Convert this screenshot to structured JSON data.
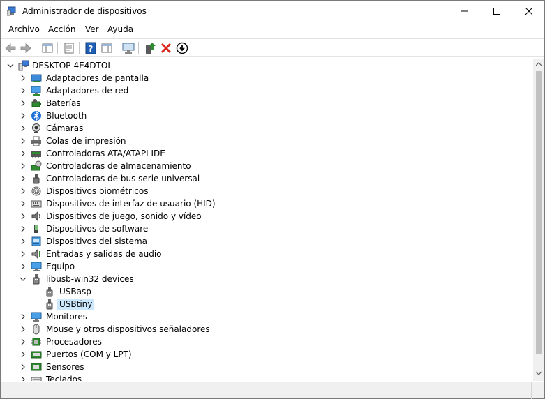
{
  "window": {
    "title": "Administrador de dispositivos"
  },
  "menu": [
    "Archivo",
    "Acción",
    "Ver",
    "Ayuda"
  ],
  "toolbar": {
    "buttons": [
      "back",
      "forward",
      "show-hide-console-tree",
      "properties",
      "help",
      "action-pane",
      "scan-hardware",
      "update-driver",
      "uninstall-device",
      "disable-device"
    ]
  },
  "tree": {
    "root": "DESKTOP-4E4DTOI",
    "items": [
      {
        "label": "Adaptadores de pantalla",
        "icon": "display-adapter-icon",
        "expanded": false
      },
      {
        "label": "Adaptadores de red",
        "icon": "network-adapter-icon",
        "expanded": false
      },
      {
        "label": "Baterías",
        "icon": "battery-icon",
        "expanded": false
      },
      {
        "label": "Bluetooth",
        "icon": "bluetooth-icon",
        "expanded": false
      },
      {
        "label": "Cámaras",
        "icon": "camera-icon",
        "expanded": false
      },
      {
        "label": "Colas de impresión",
        "icon": "printer-icon",
        "expanded": false
      },
      {
        "label": "Controladoras ATA/ATAPI IDE",
        "icon": "ide-controller-icon",
        "expanded": false
      },
      {
        "label": "Controladoras de almacenamiento",
        "icon": "storage-controller-icon",
        "expanded": false
      },
      {
        "label": "Controladoras de bus serie universal",
        "icon": "usb-controller-icon",
        "expanded": false
      },
      {
        "label": "Dispositivos biométricos",
        "icon": "fingerprint-icon",
        "expanded": false
      },
      {
        "label": "Dispositivos de interfaz de usuario (HID)",
        "icon": "hid-icon",
        "expanded": false
      },
      {
        "label": "Dispositivos de juego, sonido y vídeo",
        "icon": "speaker-icon",
        "expanded": false
      },
      {
        "label": "Dispositivos de software",
        "icon": "software-device-icon",
        "expanded": false
      },
      {
        "label": "Dispositivos del sistema",
        "icon": "system-device-icon",
        "expanded": false
      },
      {
        "label": "Entradas y salidas de audio",
        "icon": "audio-io-icon",
        "expanded": false
      },
      {
        "label": "Equipo",
        "icon": "computer-icon",
        "expanded": false
      },
      {
        "label": "libusb-win32 devices",
        "icon": "usb-plug-icon",
        "expanded": true,
        "children": [
          {
            "label": "USBasp",
            "icon": "usb-plug-icon",
            "selected": false
          },
          {
            "label": "USBtiny",
            "icon": "usb-plug-icon",
            "selected": true
          }
        ]
      },
      {
        "label": "Monitores",
        "icon": "monitor-icon",
        "expanded": false
      },
      {
        "label": "Mouse y otros dispositivos señaladores",
        "icon": "mouse-icon",
        "expanded": false
      },
      {
        "label": "Procesadores",
        "icon": "processor-icon",
        "expanded": false
      },
      {
        "label": "Puertos (COM y LPT)",
        "icon": "port-icon",
        "expanded": false
      },
      {
        "label": "Sensores",
        "icon": "sensor-icon",
        "expanded": false
      },
      {
        "label": "Teclados",
        "icon": "keyboard-icon",
        "expanded": false
      }
    ]
  },
  "colors": {
    "selection": "#cce8ff",
    "accent_green": "#2e8b2e",
    "accent_red": "#d9261c",
    "help_blue": "#1f5fb5"
  }
}
